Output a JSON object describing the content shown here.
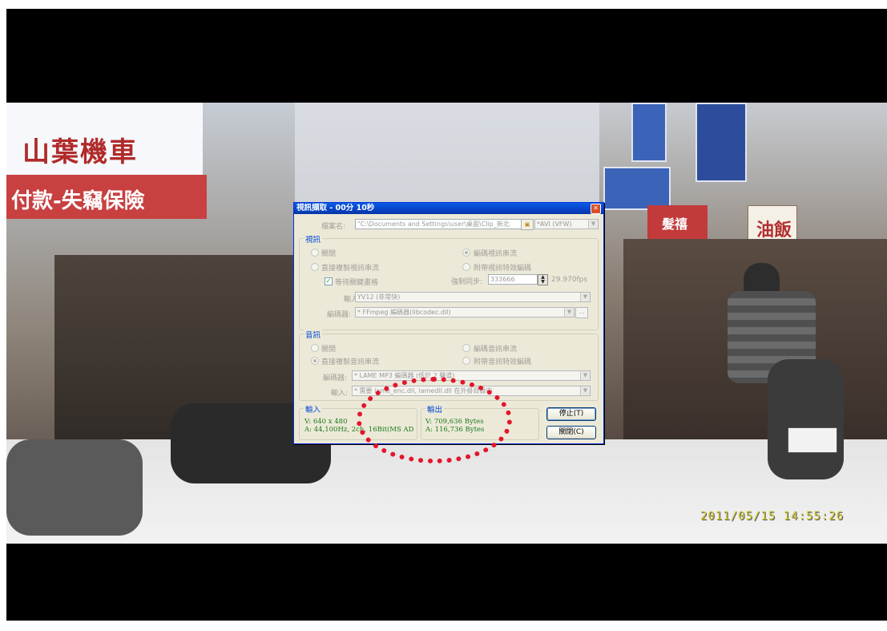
{
  "video": {
    "sign_left_top": "山葉機車",
    "sign_left_bottom": "付款-失竊保險",
    "sign_right_1": "油飯",
    "sign_right_2": "髮禧",
    "timestamp": "2011/05/15  14:55:26"
  },
  "dialog": {
    "title": "視訊擷取 - 00分 10秒",
    "close": "✕",
    "file_label": "檔案名:",
    "file_value": "\"C:\\Documents and Settings\\user\\桌面\\Clip_新北",
    "format_value": "*AVI (VFW)",
    "video_group": "視訊",
    "video_off": "關閉",
    "video_encode": "編碼視訊串流",
    "video_copy": "直接複製視訊串流",
    "video_filter": "附帶視訊特效編碼",
    "keyframe": "等待關鍵畫格",
    "sync_label": "強制同步:",
    "sync_value": "333666",
    "fps": "29.970fps",
    "input_label": "輸入:",
    "input_value": "YV12 (非常快)",
    "encoder_label": "編碼器:",
    "encoder_value": "* FFmpeg 編碼器(libcodec.dll)",
    "dots_btn": "...",
    "audio_group": "音訊",
    "audio_off": "關閉",
    "audio_encode": "編碼音訊串流",
    "audio_copy": "直接複製音訊串流",
    "audio_filter": "附帶音訊特效編碼",
    "a_encoder_label": "編碼器:",
    "a_encoder_value": "* LAME MP3 編碼器 (低於 2 聲道)",
    "a_input_label": "輸入:",
    "a_input_value": "* 需要 lame_enc.dll, lamedll.dll 在外掛目錄中",
    "in_group": "輸入",
    "in_v": "V: 640 x 480",
    "in_a": "A: 44,100Hz, 2ch, 16Bit(MS AD",
    "out_group": "輸出",
    "out_v": "V: 709,636 Bytes",
    "out_a": "A: 116,736 Bytes",
    "stop_btn": "停止(T)",
    "close_btn": "關閉(C)"
  }
}
